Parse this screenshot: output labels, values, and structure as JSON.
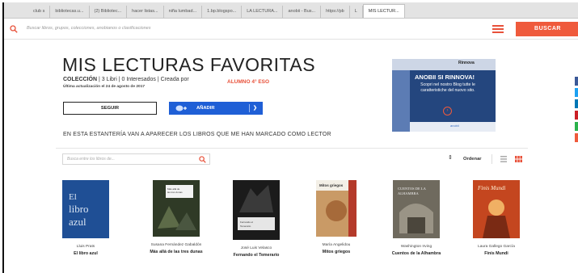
{
  "browser": {
    "tabs": [
      "club s",
      "bibliotecas.u...",
      "(2) Bibliotec...",
      "hacer listas...",
      "niña lumbad...",
      "1.bp.blogspo...",
      "LA LECTURA...",
      "anobii - Bus...",
      "https://pb",
      "L",
      "MIS LECTUR..."
    ]
  },
  "search": {
    "placeholder": "Buscar libros, grupos, colecciones, anobianos o clasificaciones",
    "button_label": "BUSCAR"
  },
  "shelf": {
    "title": "MIS LECTURAS FAVORITAS",
    "type": "COLECCIÓN",
    "books_count": "3 Libri",
    "interested": "0 Interesados",
    "created_by": "Creada por",
    "owner": "ALUMNO 4° ESO",
    "updated": "Última actualización el 24 de agosto de 2017",
    "follow_label": "SEGUIR",
    "add_label": "AÑADIR",
    "description": "EN ESTA ESTANTERÍA VAN A APARECER LOS LIBROS QUE ME HAN MARCADO COMO LECTOR"
  },
  "ad": {
    "top_word": "Rinnova",
    "headline": "ANOBII SI RINNOVA!",
    "body": "Scopri nel nostro Blog tutte le caratteristiche del nuovo sito.",
    "footer": "anobii"
  },
  "library": {
    "search_placeholder": "Busca entre los libros de...",
    "sort_label": "Ordenar"
  },
  "books": [
    {
      "author": "Lluis Prats",
      "title": "El libro azul",
      "cover_text": "El libro azul",
      "cover_color": "#1f4f95"
    },
    {
      "author": "Susana Fernández Gabaldón",
      "title": "Más allá de las tres dunas",
      "cover_text": "Más allá de las tres dunas",
      "cover_color": "#2f3a26"
    },
    {
      "author": "José Luis Velasco",
      "title": "Fernando el Temerario",
      "cover_text": "Fernando el Temerario",
      "cover_color": "#1b1b1b"
    },
    {
      "author": "María Angelidou",
      "title": "Mitos griegos",
      "cover_text": "Mitos griegos",
      "cover_color": "#c99a66"
    },
    {
      "author": "Washington Irving",
      "title": "Cuentos de la Alhambra",
      "cover_text": "Cuentos de la Alhambra",
      "cover_color": "#6f6a5e"
    },
    {
      "author": "Laura Gallego García",
      "title": "Finis Mundi",
      "cover_text": "Finis Mundi",
      "cover_color": "#c4461f"
    }
  ],
  "colors": {
    "accent": "#ef5a3c",
    "add_button": "#1f5fd6",
    "owner": "#e8513a"
  }
}
